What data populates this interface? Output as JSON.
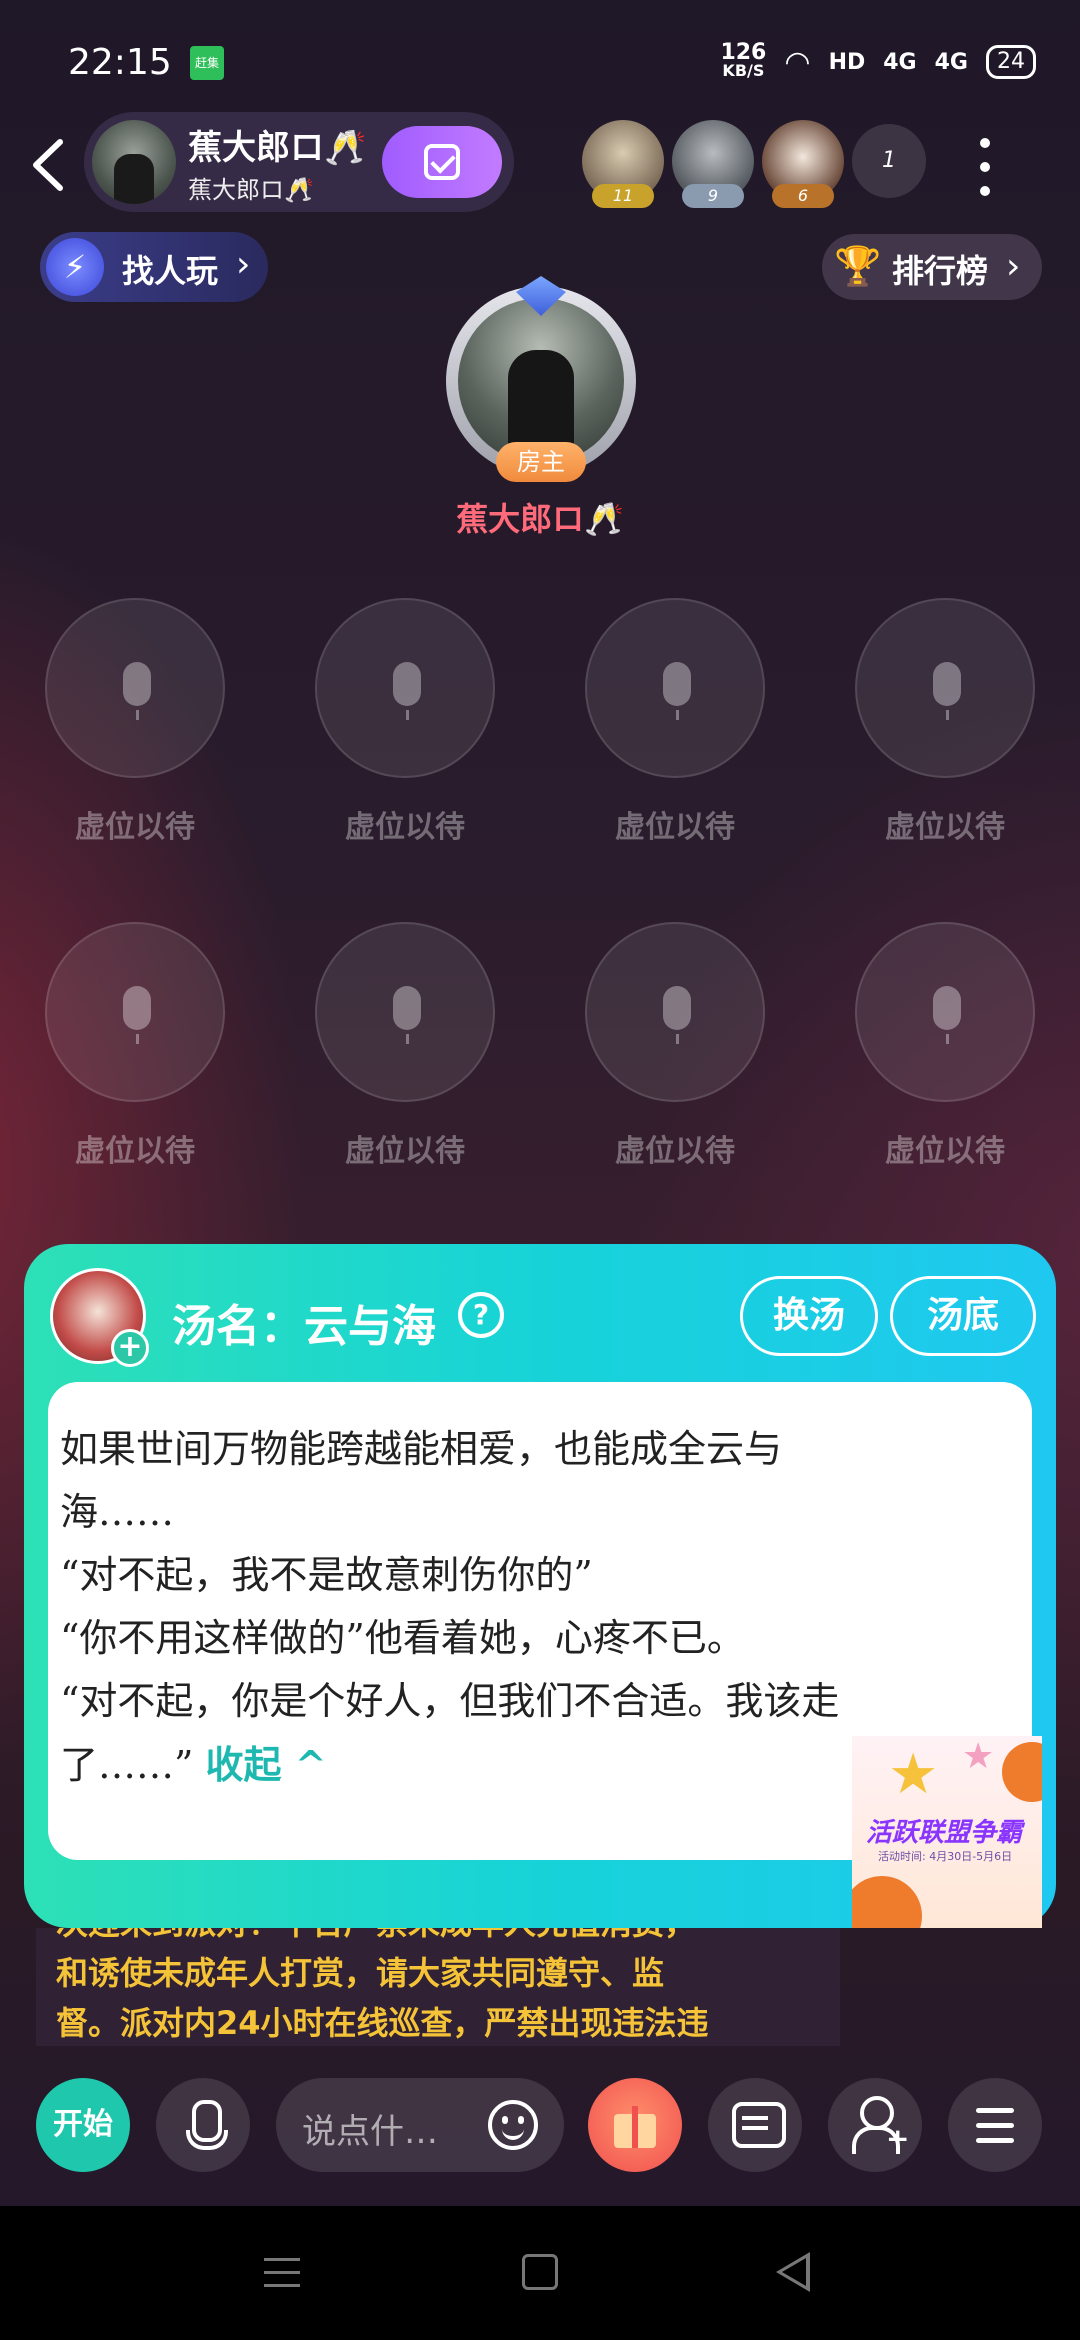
{
  "status_bar": {
    "time": "22:15",
    "app_badge": "赶集",
    "net_speed_value": "126",
    "net_speed_unit": "KB/S",
    "hd": "HD",
    "signal1": "4G",
    "signal2": "4G",
    "battery": "24"
  },
  "header": {
    "host_name": "蕉大郎ロ🥂",
    "host_sub": "蕉大郎ロ🥂",
    "viewers": [
      {
        "level": "11",
        "badge_color": "#c8a22a"
      },
      {
        "level": "9",
        "badge_color": "#8a9bb0"
      },
      {
        "level": "6",
        "badge_color": "#b9722a"
      }
    ],
    "viewer_count": "1"
  },
  "actions": {
    "find_label": "找人玩",
    "rank_label": "排行榜"
  },
  "host_seat": {
    "owner_tag": "房主",
    "name": "蕉大郎ロ🥂"
  },
  "seats": [
    {
      "label": "虚位以待"
    },
    {
      "label": "虚位以待"
    },
    {
      "label": "虚位以待"
    },
    {
      "label": "虚位以待"
    },
    {
      "label": "虚位以待"
    },
    {
      "label": "虚位以待"
    },
    {
      "label": "虚位以待"
    },
    {
      "label": "虚位以待"
    }
  ],
  "soup_card": {
    "title": "汤名：云与海",
    "help": "?",
    "swap_label": "换汤",
    "base_label": "汤底",
    "story": "如果世间万物能跨越能相爱，也能成全云与\n海……\n“对不起，我不是故意刺伤你的”\n“你不用这样做的”他看着她，心疼不已。\n“对不起，你是个好人，但我们不合适。我该走\n了……”",
    "collapse_label": "收起 ^"
  },
  "promo": {
    "title": "活跃联盟争霸",
    "sub": "活动时间: 4月30日-5月6日"
  },
  "announcement": {
    "lines": [
      "次迎来到派对！平台严禁未成年人充值消费，",
      "和诱使未成年人打赏，请大家共同遵守、监",
      "督。派对内24小时在线巡查，严禁出现违法违"
    ]
  },
  "toolbar": {
    "start_label": "开始",
    "say_placeholder": "说点什…"
  }
}
